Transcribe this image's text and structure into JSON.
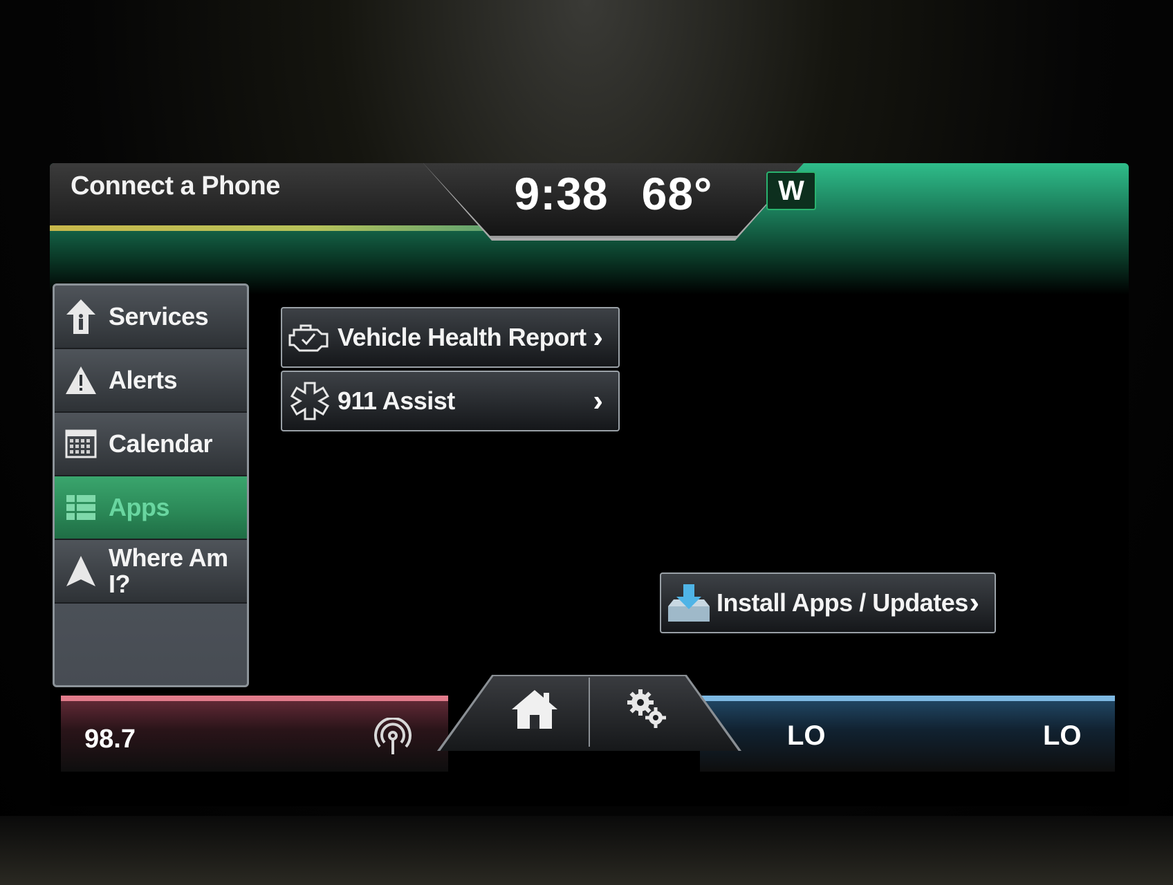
{
  "header": {
    "phone_label": "Connect a Phone",
    "time": "9:38",
    "temperature": "68°",
    "compass": "W"
  },
  "sidebar": {
    "items": [
      {
        "label": "Services",
        "icon": "services-icon",
        "active": false
      },
      {
        "label": "Alerts",
        "icon": "alert-icon",
        "active": false
      },
      {
        "label": "Calendar",
        "icon": "calendar-icon",
        "active": false
      },
      {
        "label": "Apps",
        "icon": "apps-grid-icon",
        "active": true
      },
      {
        "label": "Where Am I?",
        "icon": "navigation-arrow-icon",
        "active": false
      }
    ]
  },
  "main": {
    "buttons": [
      {
        "label": "Vehicle Health Report",
        "icon": "engine-check-icon"
      },
      {
        "label": "911 Assist",
        "icon": "medical-star-icon"
      },
      {
        "label": "Install Apps / Updates",
        "icon": "download-icon"
      }
    ],
    "chevron": "›"
  },
  "footer": {
    "radio_frequency": "98.7",
    "climate_left": "LO",
    "climate_right": "LO"
  },
  "colors": {
    "accent_green": "#2fbd8a",
    "active_tab": "#3aa56d",
    "audio_red": "#e17b8b",
    "climate_blue": "#7db8e2",
    "phone_yellow": "#c9b84b"
  }
}
